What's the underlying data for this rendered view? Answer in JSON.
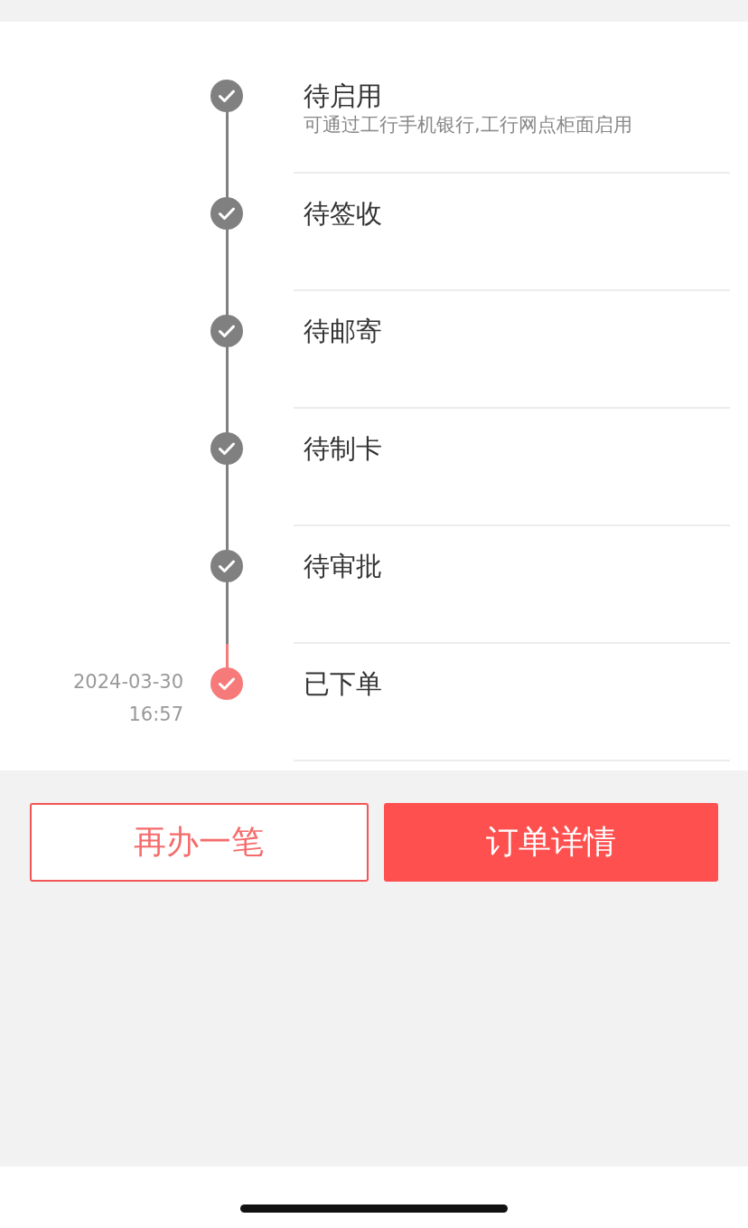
{
  "steps": [
    {
      "title": "待启用",
      "subtitle": "可通过工行手机银行,工行网点柜面启用",
      "kind": "done"
    },
    {
      "title": "待签收",
      "kind": "done"
    },
    {
      "title": "待邮寄",
      "kind": "done"
    },
    {
      "title": "待制卡",
      "kind": "done"
    },
    {
      "title": "待审批",
      "kind": "done"
    },
    {
      "title": "已下单",
      "kind": "current",
      "date": "2024-03-30",
      "time": "16:57"
    }
  ],
  "buttons": [
    {
      "label": "再办一笔",
      "kind": "outline"
    },
    {
      "label": "订单详情",
      "kind": "primary"
    }
  ]
}
